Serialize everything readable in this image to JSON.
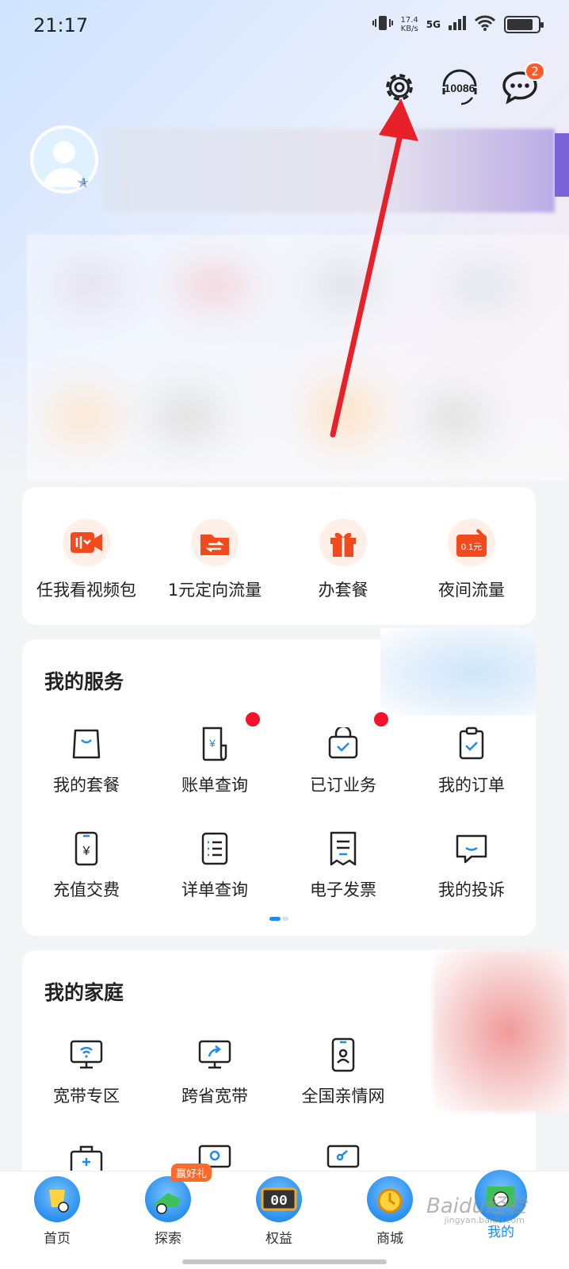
{
  "status_bar": {
    "time": "21:17",
    "net_speed_value": "17.4",
    "net_speed_unit": "KB/s",
    "network": "5G",
    "battery_level": 0.85
  },
  "header": {
    "hotline_label": "10086",
    "message_badge": "2"
  },
  "profile": {
    "level": "1"
  },
  "quick_actions": [
    {
      "label": "任我看视频包",
      "icon": "video-pack-icon"
    },
    {
      "label": "1元定向流量",
      "icon": "directed-data-icon"
    },
    {
      "label": "办套餐",
      "icon": "gift-plan-icon"
    },
    {
      "label": "夜间流量",
      "icon": "night-data-icon",
      "icon_text": "0.1元"
    }
  ],
  "my_services": {
    "title": "我的服务",
    "items": [
      {
        "label": "我的套餐",
        "icon": "bag-icon"
      },
      {
        "label": "账单查询",
        "icon": "bill-icon",
        "dot": true
      },
      {
        "label": "已订业务",
        "icon": "subscribed-icon",
        "dot": true
      },
      {
        "label": "我的订单",
        "icon": "order-icon"
      },
      {
        "label": "充值交费",
        "icon": "recharge-icon"
      },
      {
        "label": "详单查询",
        "icon": "detail-list-icon"
      },
      {
        "label": "电子发票",
        "icon": "invoice-icon"
      },
      {
        "label": "我的投诉",
        "icon": "complaint-icon"
      }
    ]
  },
  "my_family": {
    "title": "我的家庭",
    "items": [
      {
        "label": "宽带专区",
        "icon": "broadband-icon"
      },
      {
        "label": "跨省宽带",
        "icon": "cross-province-broadband-icon"
      },
      {
        "label": "全国亲情网",
        "icon": "family-network-icon"
      }
    ]
  },
  "bottom_nav": [
    {
      "label": "首页",
      "icon": "home-icon"
    },
    {
      "label": "探索",
      "icon": "explore-icon",
      "tag": "赢好礼"
    },
    {
      "label": "权益",
      "icon": "benefits-icon"
    },
    {
      "label": "商城",
      "icon": "mall-icon"
    },
    {
      "label": "我的",
      "icon": "mine-icon",
      "active": true
    }
  ],
  "watermark": {
    "text": "Baidu经验",
    "sub": "jingyan.baidu.com"
  },
  "colors": {
    "accent": "#1e8bf0",
    "orange": "#ff5a2c",
    "red_dot": "#f5132c",
    "arrow": "#e8202a"
  }
}
